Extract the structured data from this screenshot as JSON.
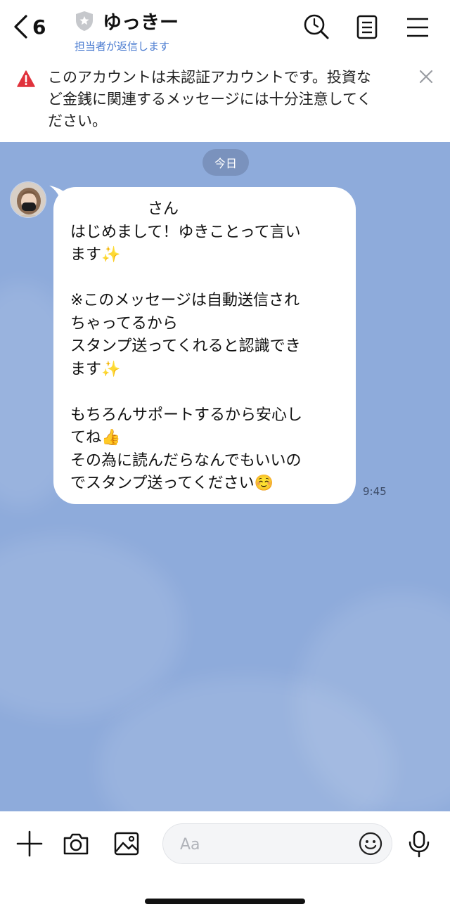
{
  "header": {
    "back_count": "6",
    "title": "ゆっきー",
    "subtitle": "担当者が返信します"
  },
  "banner": {
    "lines": [
      "このアカウントは未認証アカウントです。投資な",
      "ど金銭に関連するメッセージには十分注意してく",
      "ださい。"
    ]
  },
  "chat": {
    "date_label": "今日",
    "message": {
      "lines": [
        "　　　　　さん",
        "はじめまして！ゆきことって言い",
        "ます✨",
        "",
        "※このメッセージは自動送信され",
        "ちゃってるから",
        "スタンプ送ってくれると認識でき",
        "ます✨",
        "",
        "もちろんサポートするから安心し",
        "てね👍",
        "その為に読んだらなんでもいいの",
        "でスタンプ送ってください☺️"
      ],
      "time": "9:45"
    }
  },
  "input": {
    "placeholder": "Aa"
  },
  "colors": {
    "chat_background": "#8eabdb",
    "warning_red": "#e0323c",
    "subtitle_blue": "#4a7bd0"
  },
  "icons": [
    "back-chevron-icon",
    "shield-icon",
    "search-icon",
    "notes-icon",
    "menu-icon",
    "warning-icon",
    "close-icon",
    "plus-icon",
    "camera-icon",
    "image-icon",
    "emoji-icon",
    "microphone-icon"
  ]
}
